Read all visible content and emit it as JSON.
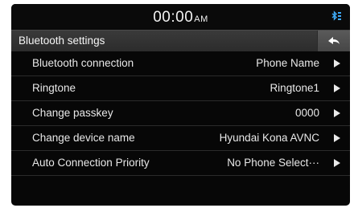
{
  "status": {
    "time": "00:00",
    "ampm": "AM",
    "bluetooth_icon": "bluetooth-phone-icon"
  },
  "header": {
    "title": "Bluetooth settings",
    "back_icon": "back-arrow-icon"
  },
  "settings": {
    "items": [
      {
        "label": "Bluetooth connection",
        "value": "Phone Name"
      },
      {
        "label": "Ringtone",
        "value": "Ringtone1"
      },
      {
        "label": "Change passkey",
        "value": "0000"
      },
      {
        "label": "Change device name",
        "value": "Hyundai Kona AVNC"
      },
      {
        "label": "Auto Connection Priority",
        "value": "No Phone Select···"
      }
    ]
  },
  "colors": {
    "background": "#070707",
    "titlebar": "#333333",
    "bluetooth_accent": "#3fa9f5"
  }
}
